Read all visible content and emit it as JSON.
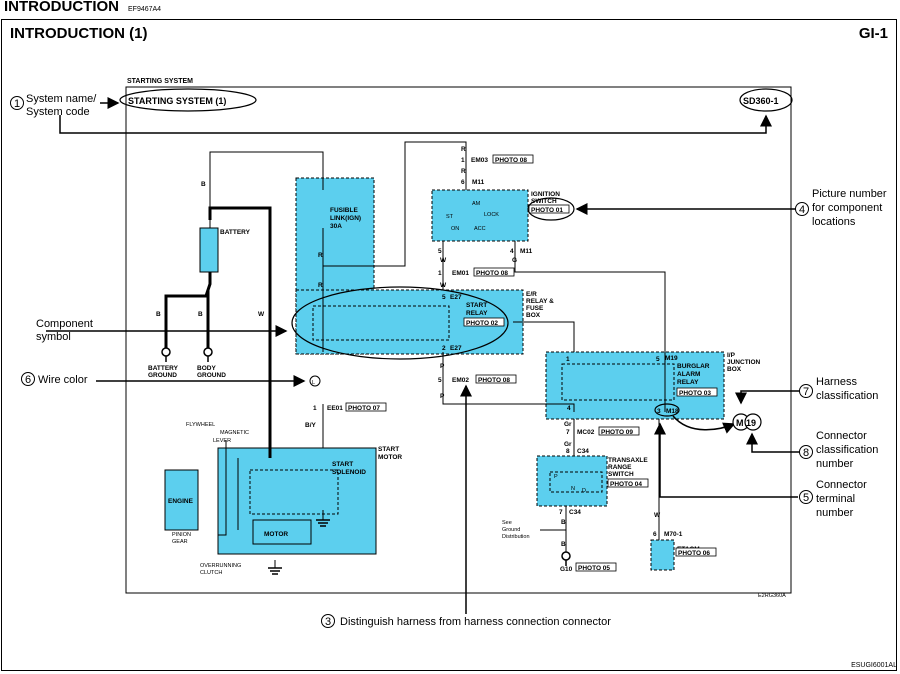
{
  "header": {
    "title": "INTRODUCTION",
    "code": "EF9467A4",
    "section_title": "INTRODUCTION (1)",
    "page_number": "GI-1",
    "footer_code": "ESUGI6001AL"
  },
  "diagram": {
    "system_label": "STARTING SYSTEM",
    "system_name": "STARTING SYSTEM (1)",
    "system_code": "SD360-1",
    "figure_code": "E2RG360A",
    "components": {
      "fusible_link": [
        "FUSIBLE",
        "LINK(IGN)",
        "30A"
      ],
      "battery": "BATTERY",
      "battery_ground": [
        "BATTERY",
        "GROUND"
      ],
      "body_ground": [
        "BODY",
        "GROUND"
      ],
      "ignition_switch": [
        "IGNITION",
        "SWITCH"
      ],
      "ignition_positions": {
        "am": "AM",
        "st": "ST",
        "lock": "LOCK",
        "on": "ON",
        "acc": "ACC"
      },
      "er_box": [
        "E/R",
        "RELAY &",
        "FUSE",
        "BOX"
      ],
      "start_relay": [
        "START",
        "RELAY"
      ],
      "ip_box": [
        "I/P",
        "JUNCTION",
        "BOX"
      ],
      "burglar_relay": [
        "BURGLAR",
        "ALARM",
        "RELAY"
      ],
      "transaxle_switch": [
        "TRANSAXLE",
        "RANGE",
        "SWITCH"
      ],
      "transaxle_letters": {
        "p": "P",
        "n": "N",
        "d": "D"
      },
      "start_motor": [
        "START",
        "MOTOR"
      ],
      "start_solenoid": [
        "START",
        "SOLENOID"
      ],
      "motor": "MOTOR",
      "engine": "ENGINE",
      "flywheel": "FLYWHEEL",
      "magnetic": "MAGNETIC",
      "lever": "LEVER",
      "pinion_gear": [
        "PINION",
        "GEAR"
      ],
      "overrunning_clutch": [
        "OVERRUNNING",
        "CLUTCH"
      ],
      "etacm": "ETACM",
      "see_ground": [
        "See",
        "Ground",
        "Distribution"
      ],
      "ground_g10": "G10"
    },
    "photos": {
      "p01": "PHOTO 01",
      "p02": "PHOTO 02",
      "p03": "PHOTO 03",
      "p04": "PHOTO 04",
      "p05": "PHOTO 05",
      "p06": "PHOTO 06",
      "p07": "PHOTO 07",
      "p08": "PHOTO 08",
      "p09": "PHOTO 09"
    },
    "connectors": {
      "em03": "EM03",
      "m11": "M11",
      "em01": "EM01",
      "e27": "E27",
      "em02": "EM02",
      "ee01": "EE01",
      "m19": "M19",
      "m18": "M18",
      "mc02": "MC02",
      "c34": "C34",
      "m70": "M70-1"
    },
    "pins": {
      "one": "1",
      "two": "2",
      "three": "3",
      "four": "4",
      "five": "5",
      "six": "6",
      "seven": "7",
      "eight": "8"
    },
    "wire_colors": {
      "b": "B",
      "w": "W",
      "r": "R",
      "p": "P",
      "by": "B/Y",
      "g": "G",
      "gr": "Gr",
      "l": "L"
    },
    "callouts": {
      "c1": {
        "num": "1",
        "text": [
          "System name/",
          "System code"
        ]
      },
      "c2": {
        "text": [
          "Component",
          "symbol"
        ]
      },
      "c3": {
        "num": "3",
        "text": "Distinguish harness from harness connection connector"
      },
      "c4": {
        "num": "4",
        "text": [
          "Picture number",
          "for component",
          "locations"
        ]
      },
      "c5": {
        "num": "5",
        "text": [
          "Connector",
          "terminal",
          "number"
        ]
      },
      "c6": {
        "num": "6",
        "text": "Wire color"
      },
      "c7": {
        "num": "7",
        "text": [
          "Harness",
          "classification"
        ]
      },
      "c8": {
        "num": "8",
        "text": [
          "Connector",
          "classification",
          "number"
        ]
      },
      "example": {
        "harness": "M",
        "number": "19"
      }
    },
    "colors": {
      "component_fill": "#5ccfee",
      "line": "#000000",
      "background": "#ffffff"
    }
  }
}
